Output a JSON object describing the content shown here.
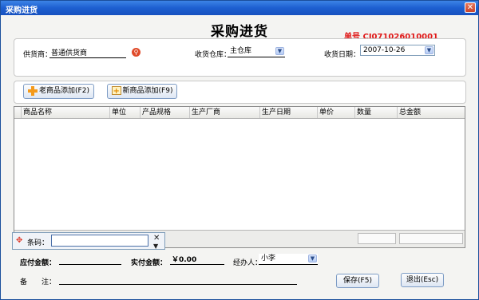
{
  "window": {
    "title": "采购进货",
    "close_glyph": "✕"
  },
  "header": {
    "heading": "采购进货",
    "order_no_label": "单号",
    "order_no": "CJ071026010001"
  },
  "form": {
    "supplier_label": "供货商：",
    "supplier_value": "普通供货商",
    "warehouse_label": "收货仓库：",
    "warehouse_value": "主仓库",
    "date_label": "收货日期：",
    "date_value": "2007-10-26"
  },
  "toolbar": {
    "old_goods_label": "老商品添加(F2)",
    "new_goods_label": "新商品添加(F9)"
  },
  "grid": {
    "columns": [
      "商品名称",
      "单位",
      "产品规格",
      "生产厂商",
      "生产日期",
      "单价",
      "数量",
      "总金额"
    ],
    "rows": []
  },
  "barcode": {
    "label": "条码：",
    "value": ""
  },
  "footer": {
    "payable_label": "应付金额：",
    "payable_value": "",
    "paid_label": "实付金额：",
    "paid_value": "￥0.00",
    "handler_label": "经办人：",
    "handler_value": "小李",
    "remark_label": "备　　注：",
    "remark_value": "",
    "save_label": "保存(F5)",
    "exit_label": "退出(Esc)"
  },
  "colors": {
    "title_bar": "#1d5fd0",
    "order_no": "#e01818",
    "accent_icon": "#f49a1b"
  },
  "icons": [
    "close-icon",
    "lookup-icon",
    "dropdown-icon",
    "add-icon",
    "new-item-icon",
    "move-icon",
    "clear-icon",
    "arrow-down-icon"
  ]
}
